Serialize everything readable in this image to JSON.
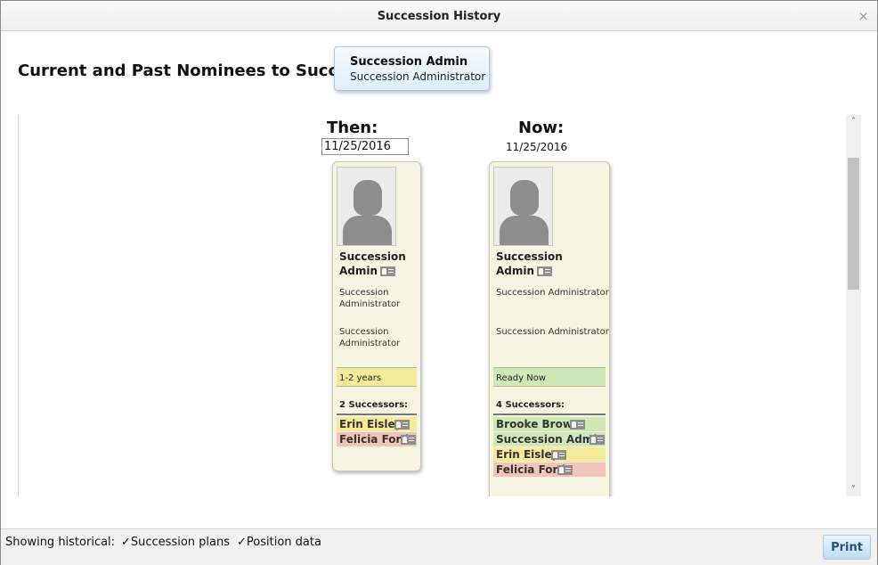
{
  "window": {
    "title": "Succession History",
    "close_icon": "×"
  },
  "heading": "Current and Past Nominees to Succeed",
  "position": {
    "name": "Succession Admin",
    "title": "Succession Administrator"
  },
  "then": {
    "label": "Then:",
    "date": "11/25/2016",
    "card": {
      "name_line1": "Succession",
      "name_line2": "Admin",
      "title1_line1": "Succession",
      "title1_line2": "Administrator",
      "title2_line1": "Succession",
      "title2_line2": "Administrator",
      "readiness": "1-2 years",
      "readiness_color": "#f4ea9a",
      "successor_count": "2 Successors:",
      "successors": [
        {
          "name": "Erin Eisley",
          "color": "#f4ea9a"
        },
        {
          "name": "Felicia Ford",
          "color": "#f3c4b8"
        }
      ]
    }
  },
  "now": {
    "label": "Now:",
    "date": "11/25/2016",
    "card": {
      "name_line1": "Succession",
      "name_line2": "Admin",
      "title1": "Succession Administrator",
      "title2": "Succession Administrator",
      "readiness": "Ready Now",
      "readiness_color": "#cfe8b7",
      "successor_count": "4 Successors:",
      "successors": [
        {
          "name": "Brooke Brown",
          "color": "#cfe8b7"
        },
        {
          "name": "Succession Admin",
          "color": "#cfe8b7"
        },
        {
          "name": "Erin Eisley",
          "color": "#f4ea9a"
        },
        {
          "name": "Felicia Ford",
          "color": "#f3c4b8"
        }
      ]
    }
  },
  "footer": {
    "showing_label": "Showing historical:",
    "check1": "✓Succession plans",
    "check2": "✓Position data",
    "print_label": "Print"
  },
  "scrollbar": {
    "up": "˄",
    "down": "˅"
  }
}
